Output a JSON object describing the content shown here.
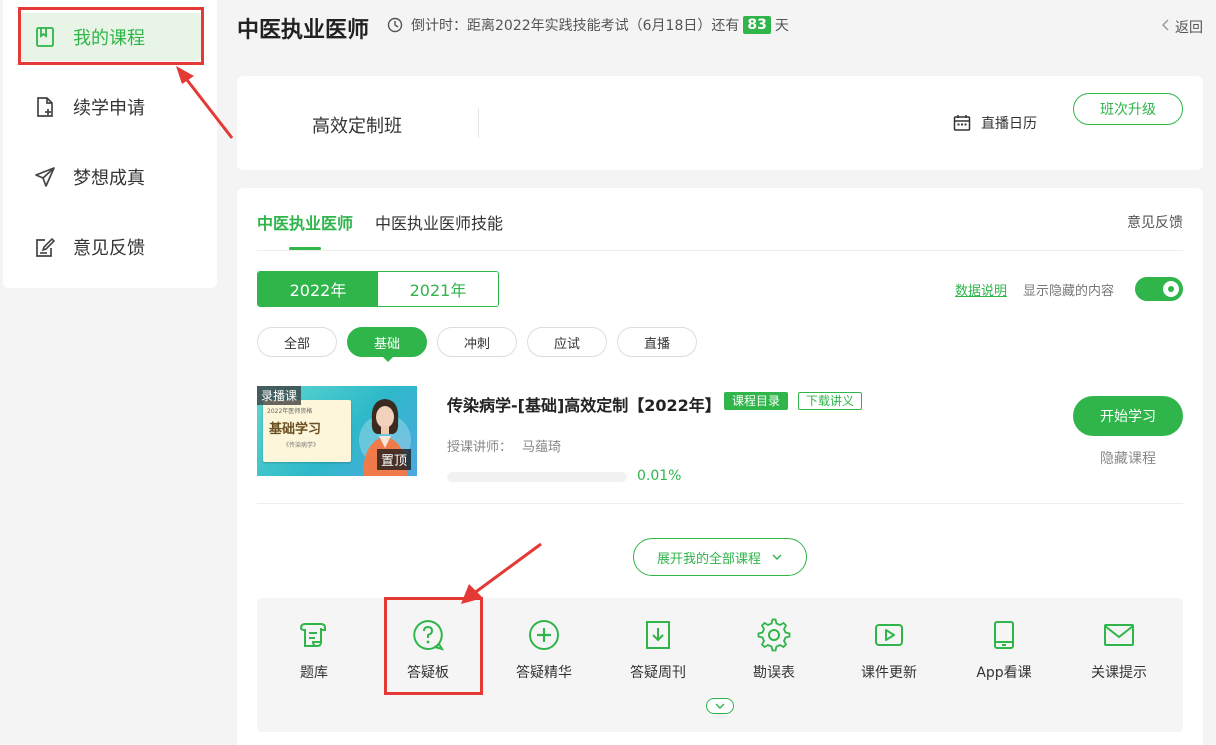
{
  "sidebar": {
    "items": [
      {
        "label": "我的课程",
        "icon": "bookmark-book-icon",
        "active": true
      },
      {
        "label": "续学申请",
        "icon": "file-add-icon",
        "active": false
      },
      {
        "label": "梦想成真",
        "icon": "paper-plane-icon",
        "active": false
      },
      {
        "label": "意见反馈",
        "icon": "edit-note-icon",
        "active": false
      }
    ]
  },
  "header": {
    "title": "中医执业医师",
    "countdown_prefix": "倒计时：距离2022年实践技能考试（6月18日）还有",
    "countdown_days": "83",
    "countdown_suffix": "天",
    "back_label": "返回"
  },
  "class_card": {
    "class_name": "高效定制班",
    "live_calendar_label": "直播日历",
    "upgrade_label": "班次升级"
  },
  "main": {
    "tabs": [
      {
        "label": "中医执业医师",
        "active": true
      },
      {
        "label": "中医执业医师技能",
        "active": false
      }
    ],
    "feedback_label": "意见反馈",
    "years": [
      {
        "label": "2022年",
        "active": true
      },
      {
        "label": "2021年",
        "active": false
      }
    ],
    "data_note_label": "数据说明",
    "show_hidden_label": "显示隐藏的内容",
    "show_hidden_on": true,
    "filters": [
      {
        "label": "全部",
        "active": false
      },
      {
        "label": "基础",
        "active": true
      },
      {
        "label": "冲刺",
        "active": false
      },
      {
        "label": "应试",
        "active": false
      },
      {
        "label": "直播",
        "active": false
      }
    ],
    "course": {
      "thumb_tag": "录播课",
      "thumb_book_small": "2022年医师资格",
      "thumb_book_title": "基础学习",
      "thumb_book_sub": "《传染病学》",
      "pin_label": "置顶",
      "title": "传染病学-[基础]高效定制【2022年】",
      "badge_catalog": "课程目录",
      "badge_download": "下载讲义",
      "teacher_label": "授课讲师：",
      "teacher_name": "马蕴琦",
      "progress_text": "0.01%",
      "progress_value": 0.0001,
      "start_label": "开始学习",
      "hide_label": "隐藏课程"
    },
    "expand_label": "展开我的全部课程"
  },
  "tools": [
    {
      "label": "题库",
      "icon": "question-bank-icon"
    },
    {
      "label": "答疑板",
      "icon": "qa-board-icon"
    },
    {
      "label": "答疑精华",
      "icon": "plus-circle-icon"
    },
    {
      "label": "答疑周刊",
      "icon": "download-doc-icon"
    },
    {
      "label": "勘误表",
      "icon": "gear-icon"
    },
    {
      "label": "课件更新",
      "icon": "video-play-icon"
    },
    {
      "label": "App看课",
      "icon": "tablet-icon"
    },
    {
      "label": "关课提示",
      "icon": "mail-icon"
    }
  ],
  "colors": {
    "accent": "#2fb54a",
    "annotation_red": "#e53935"
  }
}
